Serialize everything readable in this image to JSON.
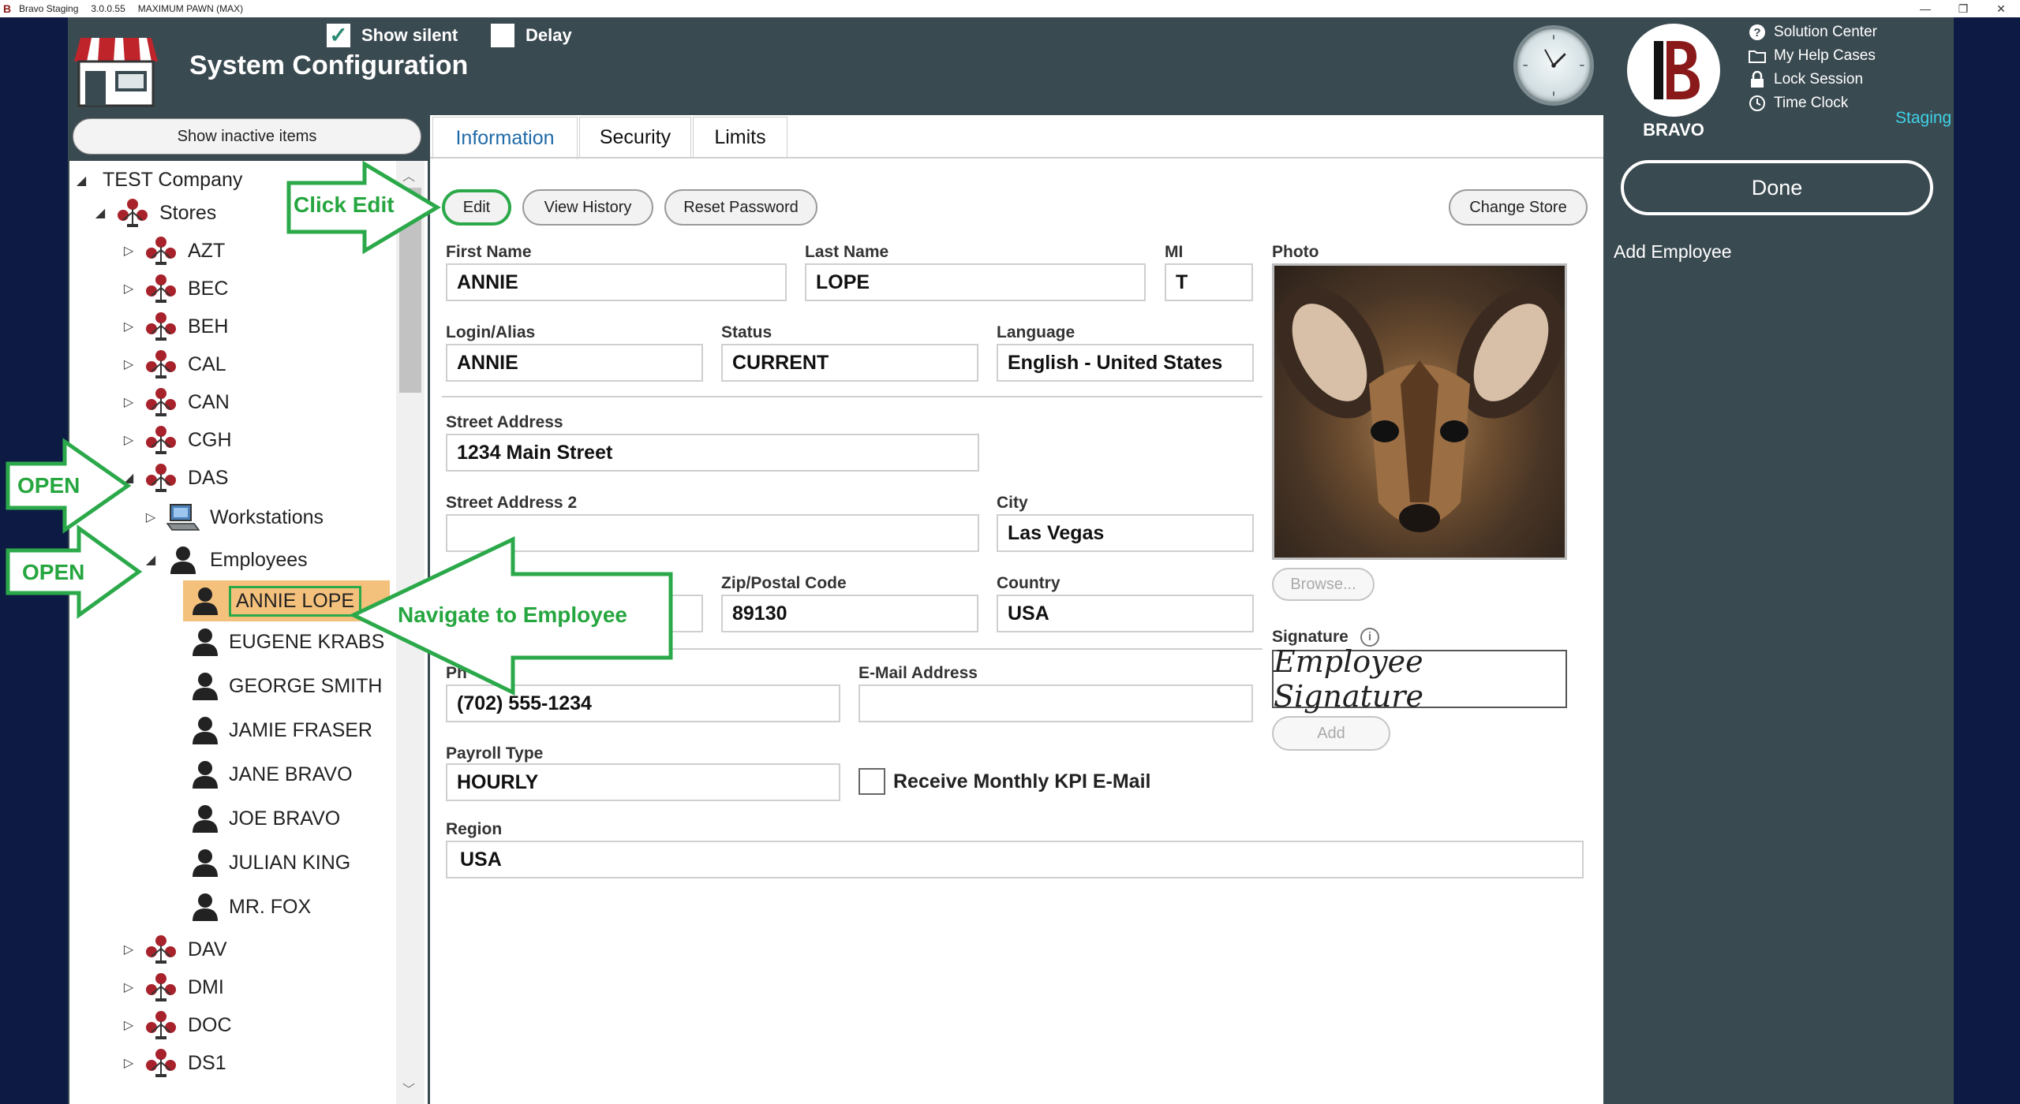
{
  "titlebar": {
    "app": "Bravo Staging",
    "version": "3.0.0.55",
    "store": "MAXIMUM PAWN (MAX)"
  },
  "header": {
    "title": "System Configuration",
    "show_silent_label": "Show silent",
    "show_silent_checked": true,
    "delay_label": "Delay",
    "delay_checked": false,
    "brand": "BRAVO",
    "links": [
      "Solution Center",
      "My Help Cases",
      "Lock Session",
      "Time Clock"
    ],
    "environment": "Staging"
  },
  "sidebar_right": {
    "done_label": "Done",
    "add_employee_label": "Add Employee"
  },
  "tree": {
    "show_inactive_label": "Show inactive items",
    "company": "TEST Company",
    "stores_label": "Stores",
    "stores_before": [
      "AZT",
      "BEC",
      "BEH",
      "CAL",
      "CAN",
      "CGH"
    ],
    "open_store": "DAS",
    "workstations_label": "Workstations",
    "employees_label": "Employees",
    "employees": [
      "ANNIE LOPE",
      "EUGENE KRABS",
      "GEORGE SMITH",
      "JAMIE FRASER",
      "JANE BRAVO",
      "JOE BRAVO",
      "JULIAN KING",
      "MR. FOX"
    ],
    "stores_after": [
      "DAV",
      "DMI",
      "DOC",
      "DS1"
    ]
  },
  "tabs": [
    "Information",
    "Security",
    "Limits"
  ],
  "actions": {
    "edit": "Edit",
    "view_history": "View History",
    "reset_password": "Reset Password",
    "change_store": "Change Store"
  },
  "form": {
    "first_name_label": "First Name",
    "first_name": "ANNIE",
    "last_name_label": "Last Name",
    "last_name": "LOPE",
    "mi_label": "MI",
    "mi": "T",
    "login_label": "Login/Alias",
    "login": "ANNIE",
    "status_label": "Status",
    "status": "CURRENT",
    "language_label": "Language",
    "language": "English - United States",
    "street_label": "Street Address",
    "street": "1234 Main Street",
    "street2_label": "Street Address 2",
    "street2": "",
    "city_label": "City",
    "city": "Las Vegas",
    "zip_label": "Zip/Postal Code",
    "zip": "89130",
    "country_label": "Country",
    "country": "USA",
    "phone_label_partial": "Ph",
    "phone": "(702) 555-1234",
    "email_label": "E-Mail Address",
    "email": "",
    "payroll_label": "Payroll Type",
    "payroll": "HOURLY",
    "kpi_label": "Receive Monthly KPI E-Mail",
    "region_label": "Region",
    "region": "USA",
    "photo_label": "Photo",
    "browse_label": "Browse...",
    "signature_label": "Signature",
    "signature_placeholder": "Employee Signature",
    "add_label": "Add"
  },
  "annotations": {
    "click_edit": "Click Edit",
    "open1": "OPEN",
    "open2": "OPEN",
    "navigate": "Navigate to Employee"
  },
  "colors": {
    "header_bg": "#3a4a51",
    "accent_green": "#26a63f",
    "selected_row": "#f4c17c",
    "staging": "#3fd3e8",
    "tab_active": "#1f6aa8"
  }
}
